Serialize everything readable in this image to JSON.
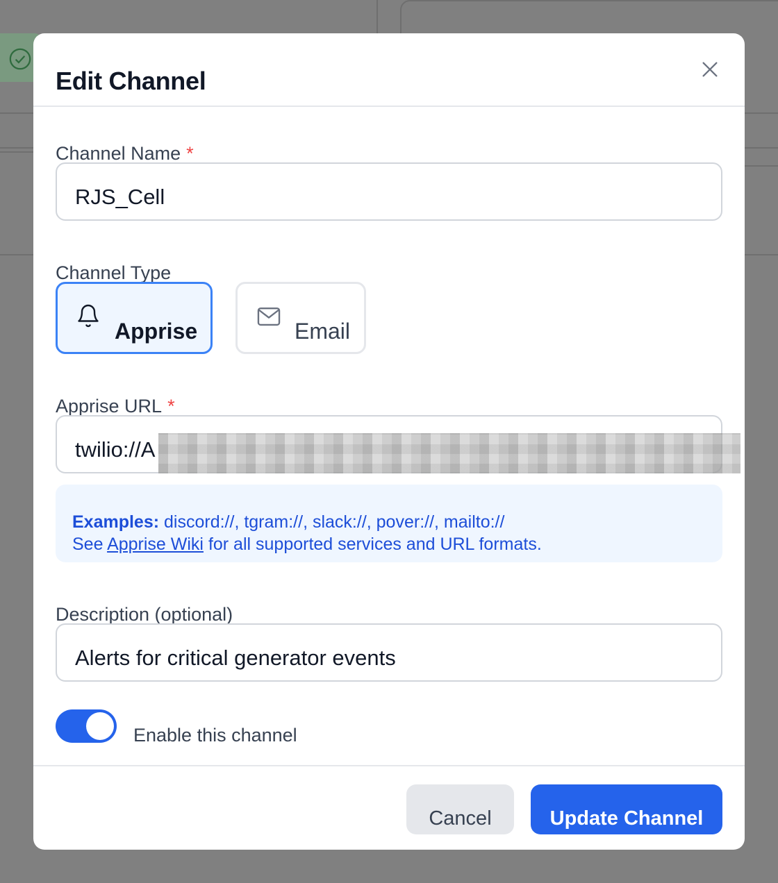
{
  "modal": {
    "title": "Edit Channel"
  },
  "form": {
    "channel_name": {
      "label": "Channel Name",
      "required_mark": "*",
      "value": "RJS_Cell"
    },
    "channel_type": {
      "label": "Channel Type",
      "options": [
        {
          "label": "Apprise",
          "icon": "bell-icon",
          "selected": true
        },
        {
          "label": "Email",
          "icon": "mail-icon",
          "selected": false
        }
      ]
    },
    "apprise_url": {
      "label": "Apprise URL",
      "required_mark": "*",
      "value": "twilio://A"
    },
    "info": {
      "examples_label": "Examples:",
      "examples_text": "discord://, tgram://, slack://, pover://, mailto://",
      "see_text": "See",
      "wiki_link": "Apprise Wiki",
      "after_link": "for all supported services and URL formats."
    },
    "description": {
      "label": "Description (optional)",
      "value": "Alerts for critical generator events"
    },
    "enable": {
      "label": "Enable this channel",
      "on": true
    }
  },
  "footer": {
    "cancel_label": "Cancel",
    "submit_label": "Update Channel"
  },
  "colors": {
    "accent": "#2563eb",
    "required": "#ef4444",
    "info_bg": "#eff6ff"
  }
}
